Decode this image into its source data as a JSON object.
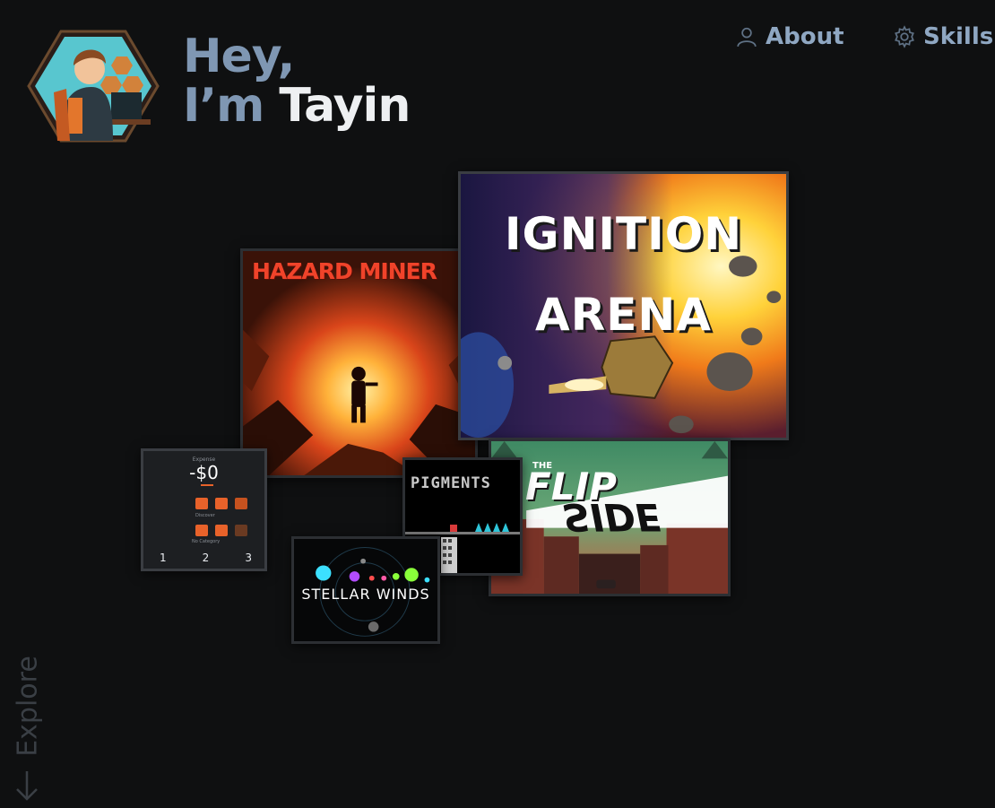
{
  "header": {
    "greeting_line1": "Hey,",
    "greeting_im": "I’m",
    "greeting_name": "Tayin"
  },
  "nav": {
    "about": "About",
    "skills": "Skills",
    "about_icon": "user-icon",
    "skills_icon": "gear-icon"
  },
  "projects": {
    "hazard_miner": "HAZARD MINER",
    "ignition_line1": "IGNITION",
    "ignition_line2": "ARENA",
    "flip_the": "THE",
    "flip_flip": "FLIP",
    "flip_side": "SIDE",
    "pigments": "PIGMENTS",
    "stellar_winds": "STELLAR WINDS",
    "budget": {
      "label": "Expense",
      "amount": "-$0",
      "discover": "Discover",
      "no_category": "No Category",
      "pages": [
        "1",
        "2",
        "3"
      ]
    }
  },
  "explore": {
    "label": "Explore"
  },
  "colors": {
    "background": "#0f1011",
    "accent_muted": "#7f97b3",
    "orange": "#e8622a"
  }
}
